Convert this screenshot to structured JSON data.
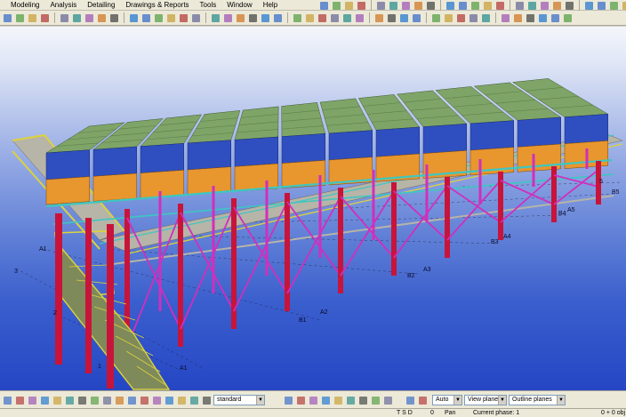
{
  "menu": {
    "items": [
      "Modeling",
      "Analysis",
      "Detailing",
      "Drawings & Reports",
      "Tools",
      "Window",
      "Help"
    ]
  },
  "icons": {
    "toolbar_top": [
      "view-icon",
      "zoom-in-icon",
      "zoom-out-icon",
      "pan-icon",
      "rotate-icon",
      "fly-icon",
      "redraw-icon",
      "undo-icon",
      "redo-icon",
      "select-icon",
      "beam-icon",
      "column-icon",
      "plate-icon",
      "bolt-icon",
      "weld-icon",
      "cut-icon",
      "fitting-icon",
      "grid-icon",
      "point-icon",
      "line-icon",
      "arc-icon",
      "measure-icon",
      "dimension-icon"
    ],
    "toolbar_second": [
      "new-icon",
      "open-icon",
      "save-icon",
      "print-icon",
      "cut-icon",
      "copy-icon",
      "paste-icon",
      "delete-icon",
      "properties-icon",
      "part-icon",
      "assembly-icon",
      "cast-unit-icon",
      "component-icon",
      "macro-icon",
      "plugin-icon",
      "move-icon",
      "copy-special-icon",
      "mirror-icon",
      "rotate-object-icon",
      "array-icon",
      "snap-icon",
      "snap-end-icon",
      "snap-mid-icon",
      "snap-center-icon",
      "snap-intersection-icon",
      "snap-perpendicular-icon",
      "snap-nearest-icon",
      "work-plane-icon",
      "clip-plane-icon",
      "numbering-icon",
      "clash-check-icon",
      "report-icon",
      "drawing-icon",
      "catalog-icon",
      "filter-icon",
      "select-filter-icon",
      "grid-toggle-icon",
      "beam-tool-icon",
      "column-tool-icon",
      "brace-tool-icon",
      "slab-tool-icon",
      "wall-tool-icon"
    ]
  },
  "bottom_toolbar": {
    "filter_value": "standard",
    "snap_depth": "Auto",
    "plane_mode": "View plane",
    "outline_mode": "Outline planes"
  },
  "statusbar": {
    "user": "T S D",
    "count": "0",
    "mode": "Pan",
    "phase": "Current phase: 1",
    "selection": "0 + 0 obj"
  },
  "grid_labels": [
    "A1",
    "3",
    "2",
    "1",
    "A1",
    "B1",
    "B2",
    "A2",
    "A3",
    "B3",
    "A4",
    "B4",
    "A5",
    "B5",
    "5",
    "A1"
  ],
  "colors": {
    "deck_green": "#7fa468",
    "cooler_blue": "#2f4fc0",
    "frame_orange": "#e8962e",
    "column_red": "#c8143a",
    "brace_magenta": "#d02fbd",
    "stair_yellow": "#dcd23c",
    "beam_cyan": "#3ec7c0",
    "walkway_grey": "#b7b4a8"
  }
}
